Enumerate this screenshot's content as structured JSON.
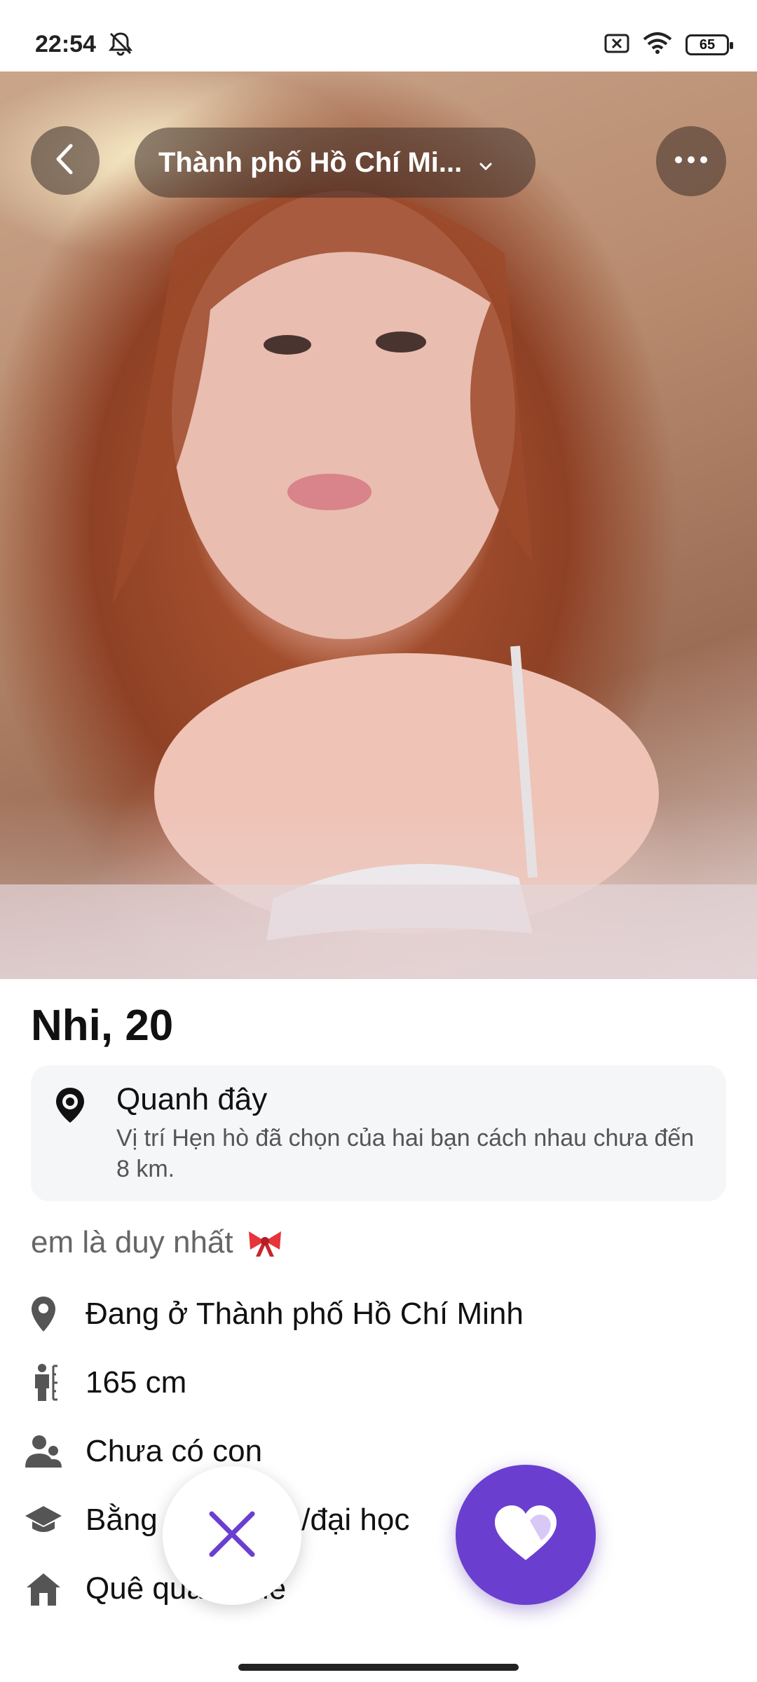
{
  "status_bar": {
    "time": "22:54",
    "battery": "65",
    "icons": [
      "mute-icon",
      "sim-blocked-icon",
      "wifi-icon",
      "battery-icon"
    ]
  },
  "header": {
    "city": "Thành phố Hồ Chí Mi...",
    "icons": [
      "back-icon",
      "chevron-down-icon",
      "more-icon"
    ]
  },
  "photo": {
    "icon": "profile-photo"
  },
  "profile": {
    "name_age": "Nhi, 20",
    "location_card": {
      "title": "Quanh đây",
      "description": "Vị trí Hẹn hò đã chọn của hai bạn cách nhau chưa đến 8 km."
    },
    "bio": "em là duy nhất",
    "details": [
      {
        "icon": "location-pin-icon",
        "text": "Đang ở Thành phố Hồ Chí Minh"
      },
      {
        "icon": "height-icon",
        "text": "165 cm"
      },
      {
        "icon": "children-icon",
        "text": "Chưa có con"
      },
      {
        "icon": "education-icon",
        "text": "Bằng cao đẳng\\/đại học"
      },
      {
        "icon": "home-icon",
        "text": "Quê quán Huế"
      }
    ]
  },
  "actions": {
    "dislike_icon": "close-icon",
    "like_icon": "heart-icon"
  },
  "colors": {
    "accent": "#6a3fd0",
    "card_bg": "#f5f6f8",
    "text_primary": "#111111",
    "text_secondary": "#555555"
  }
}
